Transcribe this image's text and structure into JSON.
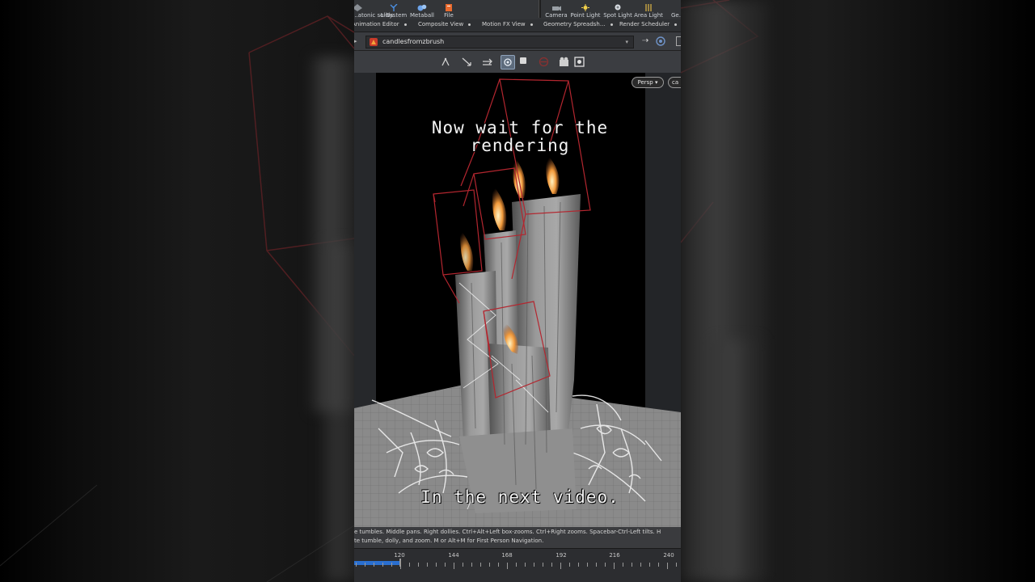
{
  "shelf": {
    "tools": [
      {
        "label": "...atonic solids",
        "icon": "platonic-solids-icon"
      },
      {
        "label": "L-System",
        "icon": "l-system-icon"
      },
      {
        "label": "Metaball",
        "icon": "metaball-icon"
      },
      {
        "label": "File",
        "icon": "file-icon"
      },
      {
        "label": "Camera",
        "icon": "camera-icon"
      },
      {
        "label": "Point Light",
        "icon": "point-light-icon"
      },
      {
        "label": "Spot Light",
        "icon": "spot-light-icon"
      },
      {
        "label": "Area Light",
        "icon": "area-light-icon"
      },
      {
        "label": "Ge...",
        "icon": "geometry-light-icon"
      }
    ]
  },
  "tabs": [
    {
      "label": "Animation Editor"
    },
    {
      "label": "Composite View"
    },
    {
      "label": "Motion FX View"
    },
    {
      "label": "Geometry Spreadsh..."
    },
    {
      "label": "Render Scheduler"
    }
  ],
  "path": {
    "node": "candlesfromzbrush",
    "icon": "houdini-object-icon"
  },
  "viewport": {
    "view_menu": "Persp",
    "camera_menu": "ca",
    "caption_top": "Now wait for the rendering",
    "caption_bottom": "In the next video."
  },
  "status": {
    "line1": "e tumbles. Middle pans. Right dollies. Ctrl+Alt+Left box-zooms. Ctrl+Right zooms. Spacebar-Ctrl-Left tilts. H",
    "line2": "te tumble, dolly, and zoom.     M or Alt+M for First Person Navigation."
  },
  "timeline": {
    "labels": [
      "120",
      "144",
      "168",
      "192",
      "216",
      "240"
    ],
    "playback_range_end": "120"
  },
  "colors": {
    "accent": "#2a6fd0",
    "bbox": "#b3262f",
    "flame": "#f29a3b"
  }
}
